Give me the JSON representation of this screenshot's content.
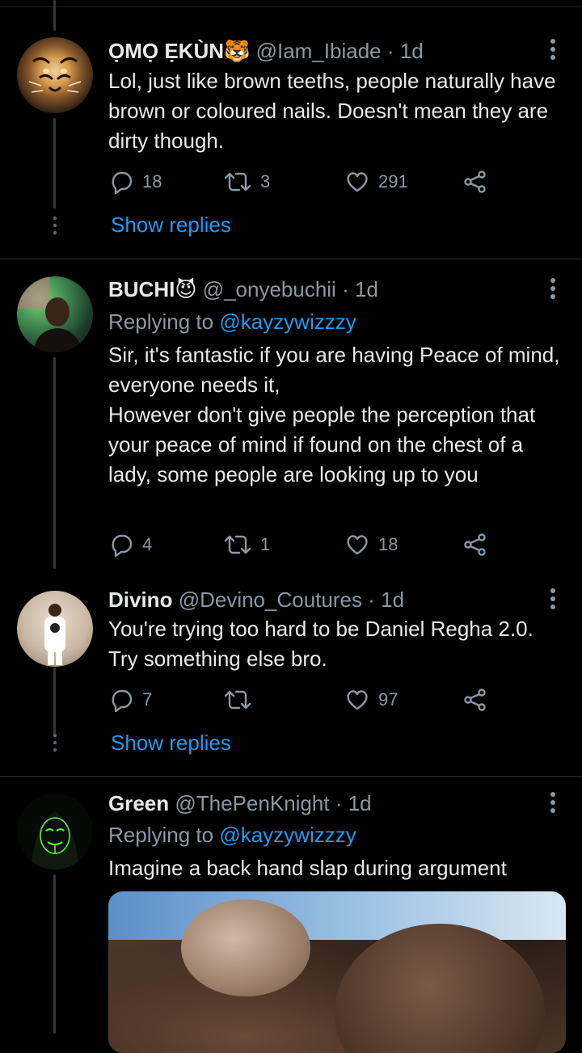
{
  "tweets": [
    {
      "name": "ỌMỌ ẸKÙN🐯",
      "handle": "@Iam_Ibiade",
      "time": "1d",
      "replying_to": "",
      "text": "Lol, just like brown teeths, people naturally have brown or coloured nails. Doesn't mean they are dirty though.",
      "replies": "18",
      "retweets": "3",
      "likes": "291",
      "show_replies": "Show replies"
    },
    {
      "name": "BUCHI😈",
      "handle": "@_onyebuchii",
      "time": "1d",
      "replying_to_label": "Replying to",
      "replying_to": "@kayzywizzzy",
      "text": "Sir, it's fantastic if you are having Peace of mind, everyone needs it,\nHowever don't give people the perception that your peace of mind if found on the chest of a lady, some people are looking up to you",
      "replies": "4",
      "retweets": "1",
      "likes": "18"
    },
    {
      "name": "Divino",
      "handle": "@Devino_Coutures",
      "time": "1d",
      "text": "You're trying too hard to be Daniel Regha 2.0. Try something else bro.",
      "replies": "7",
      "retweets": "",
      "likes": "97",
      "show_replies": "Show replies"
    },
    {
      "name": "Green",
      "handle": "@ThePenKnight",
      "time": "1d",
      "replying_to_label": "Replying to",
      "replying_to": "@kayzywizzzy",
      "text": "Imagine a back hand slap during argument"
    }
  ],
  "separator": "·",
  "colors": {
    "background": "#000000",
    "text": "#e7e9ea",
    "muted": "#8b98a5",
    "accent": "#1d9bf0",
    "divider": "#2f3336"
  },
  "icons": [
    "reply-icon",
    "retweet-icon",
    "like-icon",
    "share-icon",
    "more-icon"
  ]
}
